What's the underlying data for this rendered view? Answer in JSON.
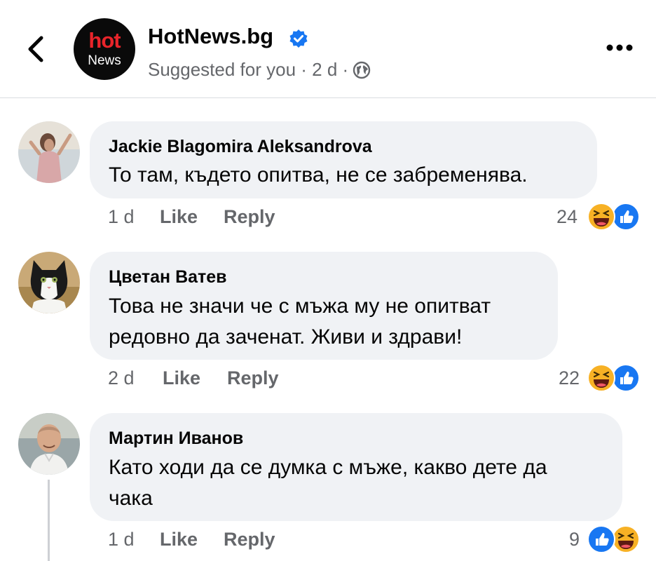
{
  "header": {
    "page_name": "HotNews.bg",
    "logo_top": "hot",
    "logo_bottom": "News",
    "subtitle": "Suggested for you · 2 d ·"
  },
  "comments": [
    {
      "author": "Jackie Blagomira Aleksandrova",
      "lines": [
        "То там, където опитва, не се забременява."
      ],
      "time": "1 d",
      "like": "Like",
      "reply": "Reply",
      "reaction_count": "24",
      "reactions": [
        "haha-icon",
        "like-icon"
      ]
    },
    {
      "author": "Цветан Ватев",
      "lines": [
        "Това не значи че с мъжа му не опитват",
        "редовно да заченат. Живи и здрави!"
      ],
      "time": "2 d",
      "like": "Like",
      "reply": "Reply",
      "reaction_count": "22",
      "reactions": [
        "haha-icon",
        "like-icon"
      ]
    },
    {
      "author": "Мартин Иванов",
      "lines": [
        "Като ходи да се думка с мъже, какво дете да",
        "чака"
      ],
      "time": "1 d",
      "like": "Like",
      "reply": "Reply",
      "reaction_count": "9",
      "reactions": [
        "like-icon",
        "haha-icon"
      ]
    }
  ],
  "colors": {
    "accent_blue": "#1877f2",
    "haha_yellow": "#f7b125",
    "muted_text": "#65676b",
    "bubble_bg": "#f0f2f5",
    "logo_red": "#e8242a"
  }
}
